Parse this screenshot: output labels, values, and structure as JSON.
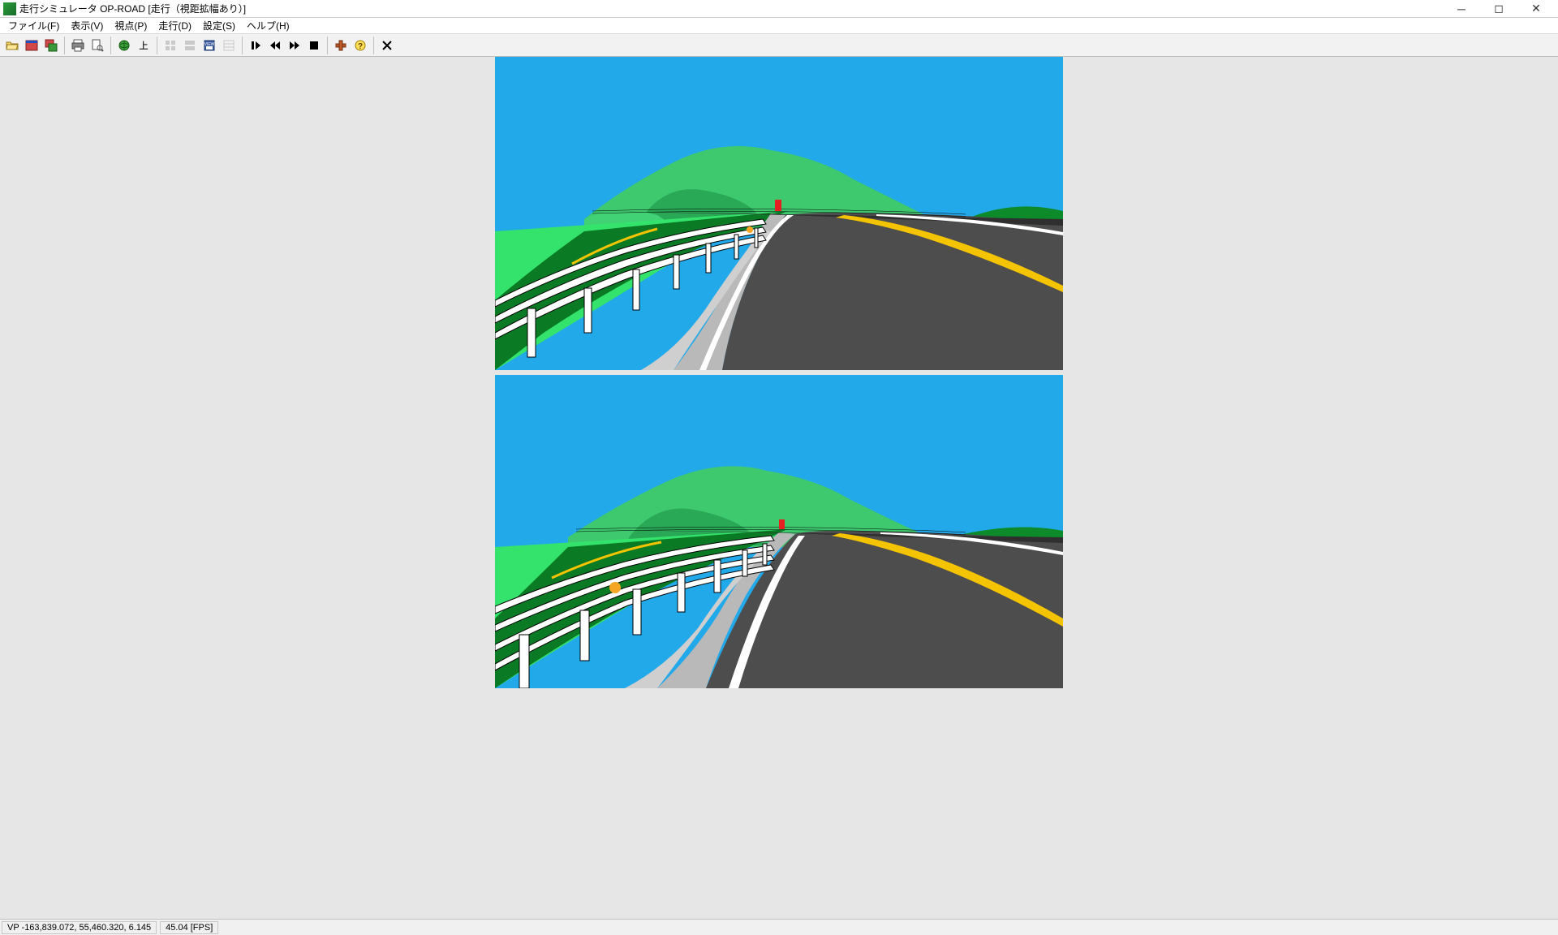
{
  "window": {
    "title": "走行シミュレータ OP-ROAD [走行（視距拡幅あり）]"
  },
  "menu": {
    "file": "ファイル(F)",
    "view": "表示(V)",
    "viewpoint": "視点(P)",
    "drive": "走行(D)",
    "settings": "設定(S)",
    "help": "ヘルプ(H)"
  },
  "toolbar": {
    "open": "開く",
    "window1": "ウィンドウ1",
    "window2": "ウィンドウ2",
    "print": "印刷",
    "print_preview": "印刷プレビュー",
    "globe": "全景",
    "up": "上",
    "view_a": "視点A",
    "view_b": "視点B",
    "save_view": "視点保存",
    "view_c": "視点C",
    "play": "再生",
    "rewind": "巻き戻し",
    "fast_forward": "早送り",
    "stop": "停止",
    "tool1": "ツール",
    "help": "ヘルプ",
    "close": "閉じる"
  },
  "status": {
    "vp": "VP -163,839.072, 55,460.320, 6.145",
    "fps": "45.04 [FPS]"
  },
  "colors": {
    "sky": "#22a9ea",
    "mountain_light": "#3ec96f",
    "mountain_dark": "#0d8a2a",
    "grass": "#34e36b",
    "grass_dark": "#0a7a24",
    "road": "#4d4d4d",
    "shoulder": "#b9b9b9",
    "line_white": "#ffffff",
    "line_yellow": "#f5c400",
    "guardrail": "#ffffff",
    "marker_red": "#e62020",
    "marker_orange": "#f5a623"
  }
}
